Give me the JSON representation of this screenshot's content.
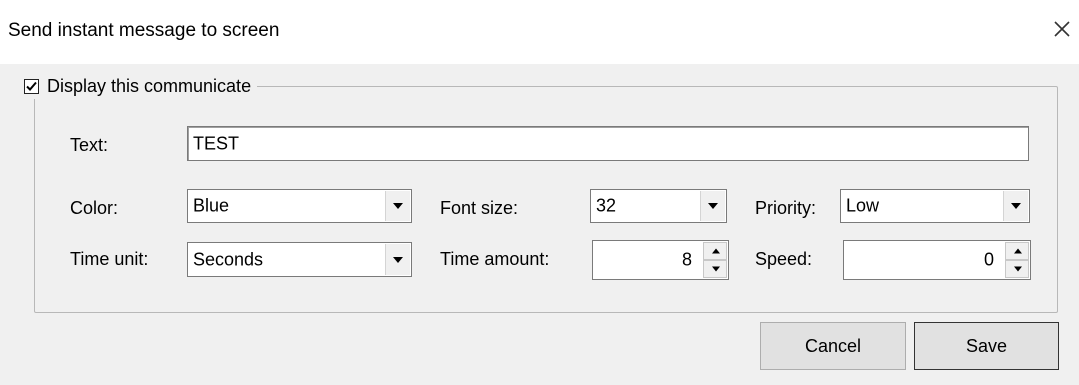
{
  "window": {
    "title": "Send instant message to screen"
  },
  "group": {
    "checkbox_label": "Display this communicate",
    "checked": true
  },
  "fields": {
    "text_label": "Text:",
    "text_value": "TEST",
    "color_label": "Color:",
    "color_value": "Blue",
    "font_size_label": "Font size:",
    "font_size_value": "32",
    "priority_label": "Priority:",
    "priority_value": "Low",
    "time_unit_label": "Time unit:",
    "time_unit_value": "Seconds",
    "time_amount_label": "Time amount:",
    "time_amount_value": "8",
    "speed_label": "Speed:",
    "speed_value": "0"
  },
  "buttons": {
    "cancel": "Cancel",
    "save": "Save"
  },
  "icons": {
    "close": "close-icon",
    "checkbox": "checkmark-icon",
    "dropdown": "chevron-down-icon",
    "spin_up": "spin-up-icon",
    "spin_down": "spin-down-icon"
  }
}
